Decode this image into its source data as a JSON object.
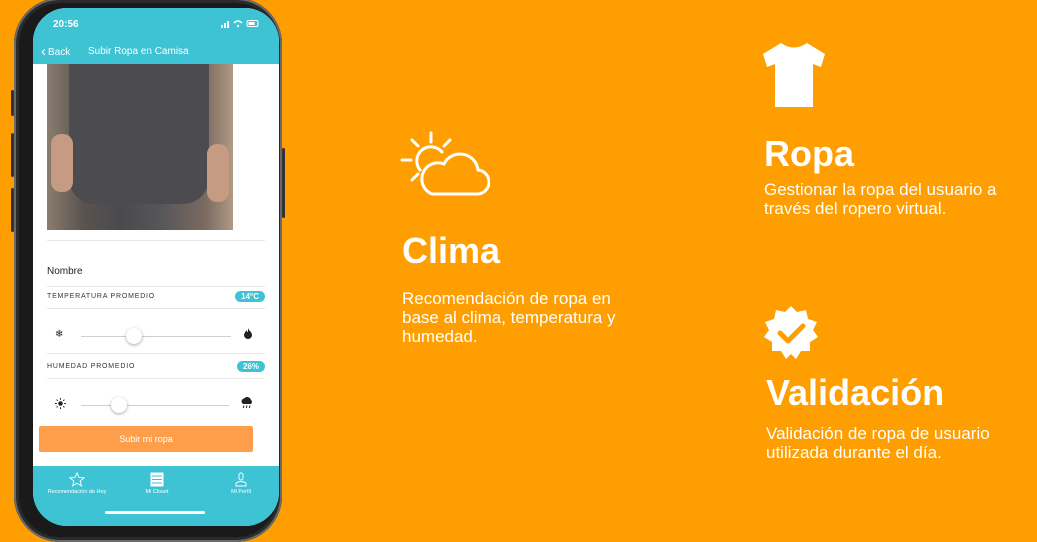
{
  "phone": {
    "status_time": "20:56",
    "status_icons": "..ll ᯤ ▭",
    "nav": {
      "back_label": "Back",
      "title": "Subir Ropa en Camisa"
    },
    "form": {
      "name_label": "Nombre",
      "temperature_label": "TEMPERATURA PROMEDIO",
      "temperature_value": "14°C",
      "temperature_slider_fraction": 0.35,
      "humidity_label": "HUMEDAD PROMEDIO",
      "humidity_value": "26%",
      "humidity_slider_fraction": 0.26,
      "submit_label": "Subir mi ropa"
    },
    "tabbar": [
      {
        "label": "Recomendación de Hoy",
        "icon": "star-icon"
      },
      {
        "label": "Mi Closet",
        "icon": "list-icon"
      },
      {
        "label": "Mi Perfil",
        "icon": "person-icon"
      }
    ]
  },
  "features": {
    "clima": {
      "title": "Clima",
      "description": "Recomendación de ropa en base al clima, temperatura y humedad.",
      "icon": "sun-cloud-icon"
    },
    "ropa": {
      "title": "Ropa",
      "description": "Gestionar la ropa del usuario a través del ropero virtual.",
      "icon": "tshirt-icon"
    },
    "validacion": {
      "title": "Validación",
      "description": "Validación de ropa de usuario utilizada durante el día.",
      "icon": "verified-badge-icon"
    }
  },
  "colors": {
    "background": "#FF9E00",
    "app_accent": "#3EC3D5",
    "button": "#FF9E4A"
  }
}
